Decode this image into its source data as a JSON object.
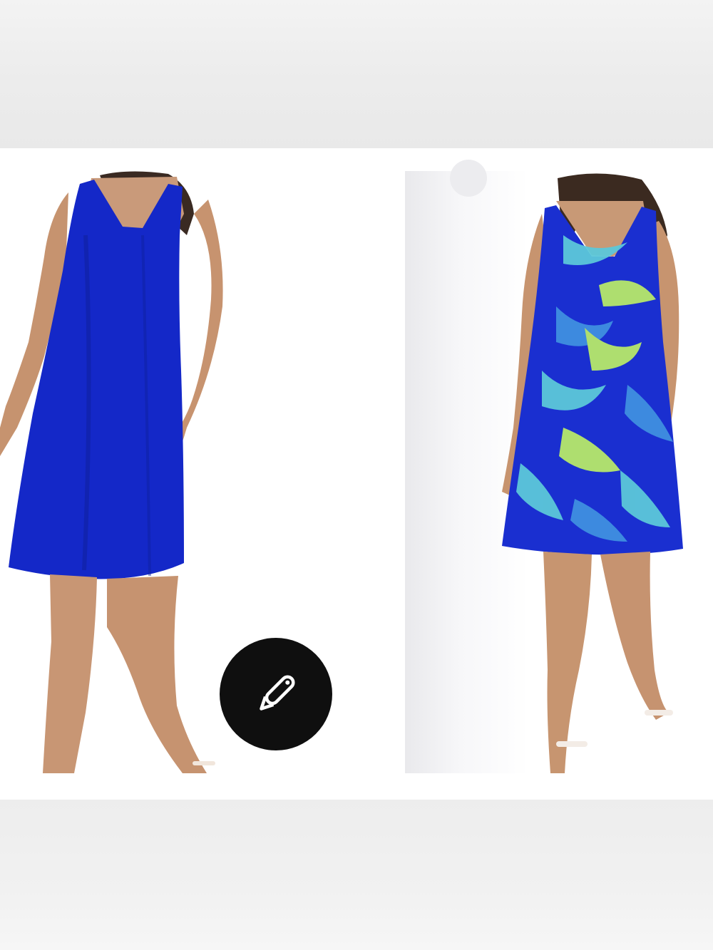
{
  "images": [
    {
      "name": "solid-blue-dress-photo",
      "dress_color": "#1428c8"
    },
    {
      "name": "tropical-print-dress-photo",
      "dress_color": "#1a2fd0",
      "print_colors": [
        "#5cc7d9",
        "#b6e86a",
        "#3f8fe0"
      ]
    }
  ],
  "edit_button": {
    "icon": "pencil-icon",
    "background": "#0f0f0f",
    "icon_color": "#ffffff"
  }
}
